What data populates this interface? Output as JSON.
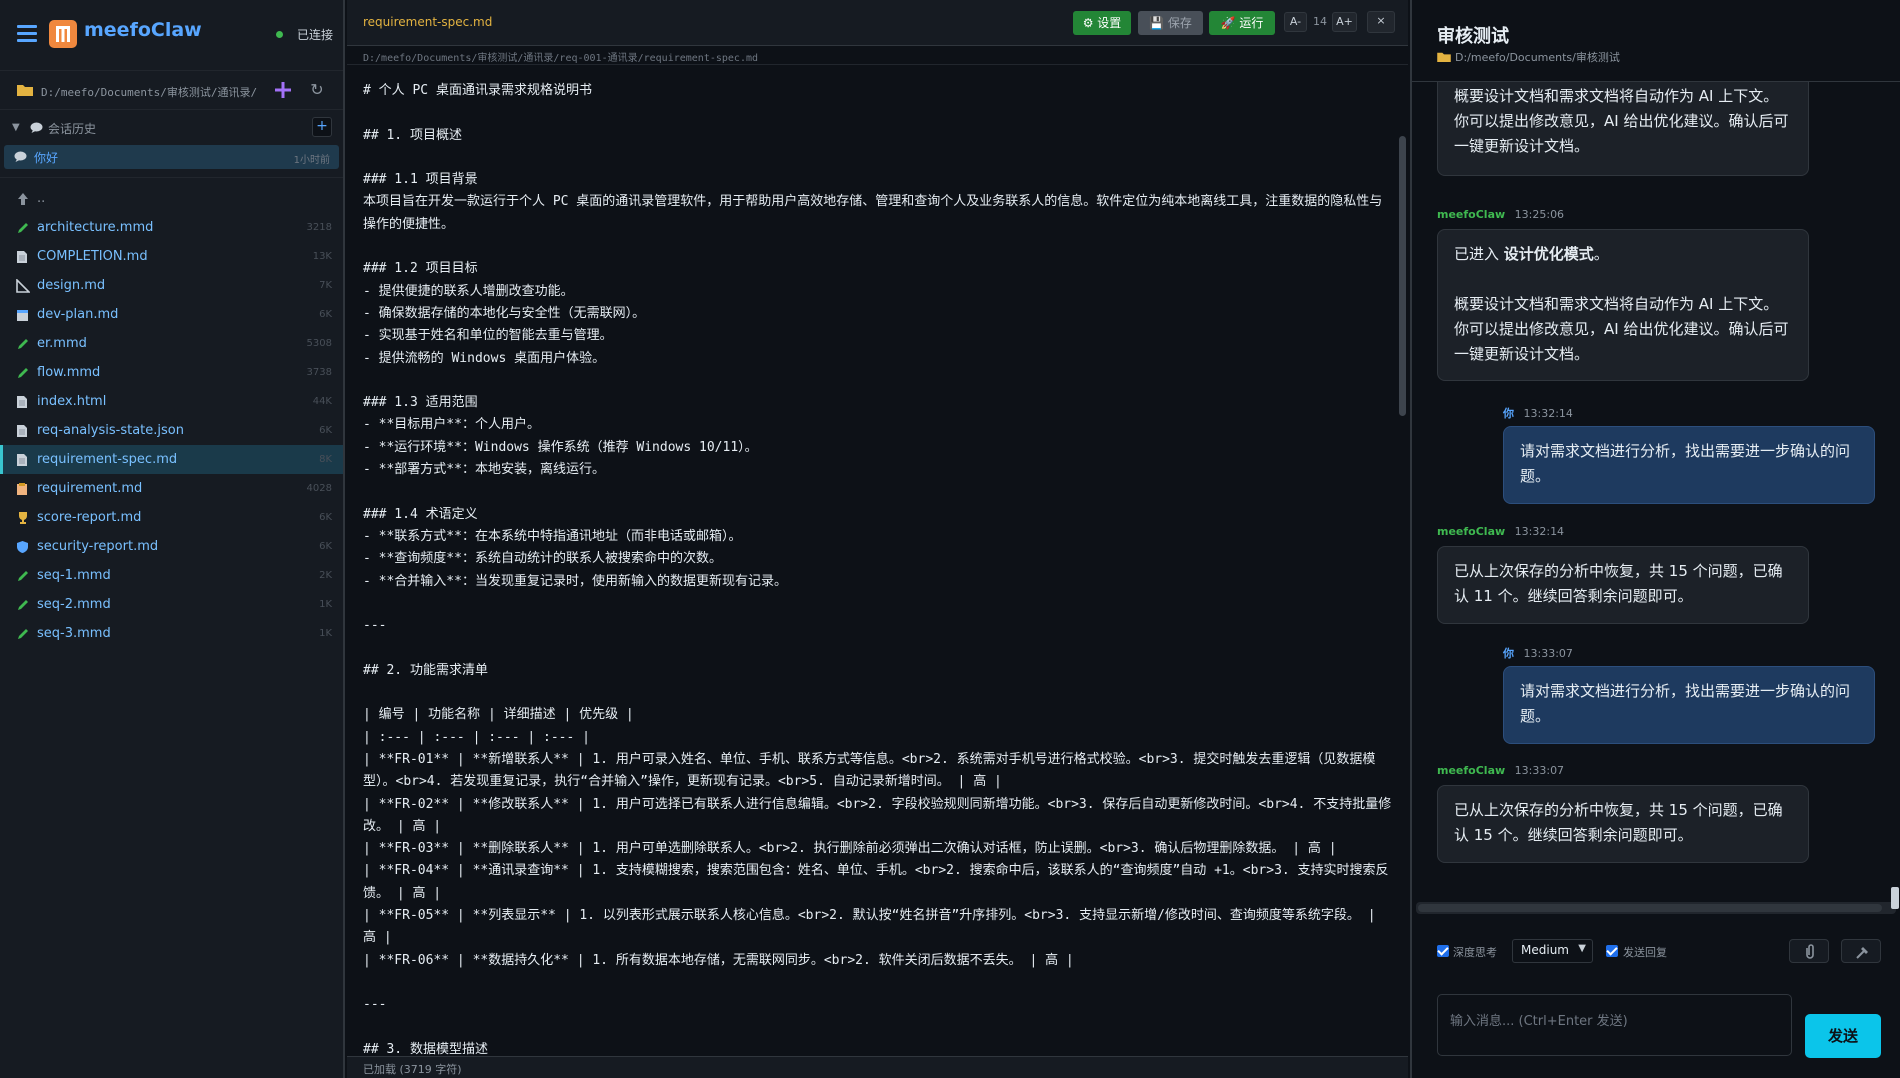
{
  "sidebar": {
    "app_name": "meefoClaw",
    "connection_status": "已连接",
    "current_path": "D:/meefo/Documents/审核测试/通讯录/r...",
    "history_label": "会话历史",
    "history_add": "+",
    "session": {
      "label": "你好",
      "time": "1小时前"
    },
    "parent_dir": "..",
    "files": [
      {
        "name": "architecture.mmd",
        "size": "3218",
        "icon": "pencil-icon"
      },
      {
        "name": "COMPLETION.md",
        "size": "13K",
        "icon": "document-icon"
      },
      {
        "name": "design.md",
        "size": "7K",
        "icon": "ruler-icon"
      },
      {
        "name": "dev-plan.md",
        "size": "6K",
        "icon": "calendar-icon"
      },
      {
        "name": "er.mmd",
        "size": "5308",
        "icon": "pencil-icon"
      },
      {
        "name": "flow.mmd",
        "size": "3738",
        "icon": "pencil-icon"
      },
      {
        "name": "index.html",
        "size": "44K",
        "icon": "document-icon"
      },
      {
        "name": "req-analysis-state.json",
        "size": "6K",
        "icon": "document-icon"
      },
      {
        "name": "requirement-spec.md",
        "size": "8K",
        "icon": "document-icon",
        "active": true
      },
      {
        "name": "requirement.md",
        "size": "4028",
        "icon": "clipboard-icon"
      },
      {
        "name": "score-report.md",
        "size": "6K",
        "icon": "trophy-icon"
      },
      {
        "name": "security-report.md",
        "size": "6K",
        "icon": "shield-icon"
      },
      {
        "name": "seq-1.mmd",
        "size": "2K",
        "icon": "pencil-icon"
      },
      {
        "name": "seq-2.mmd",
        "size": "1K",
        "icon": "pencil-icon"
      },
      {
        "name": "seq-3.mmd",
        "size": "1K",
        "icon": "pencil-icon"
      }
    ]
  },
  "editor": {
    "filename": "requirement-spec.md",
    "settings_label": "设置",
    "save_label": "保存",
    "run_label": "运行",
    "font_dec": "A-",
    "font_size": "14",
    "font_inc": "A+",
    "close": "×",
    "path": "D:/meefo/Documents/审核测试/通讯录/req-001-通讯录/requirement-spec.md",
    "status": "已加载 (3719 字符)",
    "lines": [
      "# 个人 PC 桌面通讯录需求规格说明书",
      "",
      "## 1. 项目概述",
      "",
      "### 1.1 项目背景",
      "本项目旨在开发一款运行于个人 PC 桌面的通讯录管理软件，用于帮助用户高效地存储、管理和查询个人及业务联系人的信息。软件定位为纯本地离线工具，注重数据的隐私性与操作的便捷性。",
      "",
      "### 1.2 项目目标",
      "- 提供便捷的联系人增删改查功能。",
      "- 确保数据存储的本地化与安全性（无需联网）。",
      "- 实现基于姓名和单位的智能去重与管理。",
      "- 提供流畅的 Windows 桌面用户体验。",
      "",
      "### 1.3 适用范围",
      "- **目标用户**：个人用户。",
      "- **运行环境**：Windows 操作系统（推荐 Windows 10/11）。",
      "- **部署方式**：本地安装，离线运行。",
      "",
      "### 1.4 术语定义",
      "- **联系方式**：在本系统中特指通讯地址（而非电话或邮箱）。",
      "- **查询频度**：系统自动统计的联系人被搜索命中的次数。",
      "- **合并输入**：当发现重复记录时，使用新输入的数据更新现有记录。",
      "",
      "---",
      "",
      "## 2. 功能需求清单",
      "",
      "| 编号 | 功能名称 | 详细描述 | 优先级 |",
      "| :--- | :--- | :--- | :--- |",
      "| **FR-01** | **新增联系人** | 1. 用户可录入姓名、单位、手机、联系方式等信息。<br>2. 系统需对手机号进行格式校验。<br>3. 提交时触发去重逻辑（见数据模型）。<br>4. 若发现重复记录，执行“合并输入”操作，更新现有记录。<br>5. 自动记录新增时间。 | 高 |",
      "| **FR-02** | **修改联系人** | 1. 用户可选择已有联系人进行信息编辑。<br>2. 字段校验规则同新增功能。<br>3. 保存后自动更新修改时间。<br>4. 不支持批量修改。 | 高 |",
      "| **FR-03** | **删除联系人** | 1. 用户可单选删除联系人。<br>2. 执行删除前必须弹出二次确认对话框，防止误删。<br>3. 确认后物理删除数据。 | 高 |",
      "| **FR-04** | **通讯录查询** | 1. 支持模糊搜索，搜索范围包含：姓名、单位、手机。<br>2. 搜索命中后，该联系人的“查询频度”自动 +1。<br>3. 支持实时搜索反馈。 | 高 |",
      "| **FR-05** | **列表显示** | 1. 以列表形式展示联系人核心信息。<br>2. 默认按“姓名拼音”升序排列。<br>3. 支持显示新增/修改时间、查询频度等系统字段。 | 高 |",
      "| **FR-06** | **数据持久化** | 1. 所有数据本地存储，无需联网同步。<br>2. 软件关闭后数据不丢失。 | 高 |",
      "",
      "---",
      "",
      "## 3. 数据模型描述"
    ]
  },
  "chat": {
    "title": "审核测试",
    "path": "D:/meefo/Documents/审核测试",
    "messages": [
      {
        "role": "ai",
        "who": "",
        "time": "",
        "paras": [
          "概要设计文档和需求文档将自动作为 AI 上下文。你可以提出修改意见，AI 给出优化建议。确认后可一键更新设计文档。"
        ]
      },
      {
        "role": "ai",
        "who": "meefoClaw",
        "time": "13:25:06",
        "paras": [
          "已进入 ",
          "设计优化模式",
          "。",
          "概要设计文档和需求文档将自动作为 AI 上下文。你可以提出修改意见，AI 给出优化建议。确认后可一键更新设计文档。"
        ]
      },
      {
        "role": "me",
        "who": "你",
        "time": "13:32:14",
        "paras": [
          "请对需求文档进行分析，找出需要进一步确认的问题。"
        ]
      },
      {
        "role": "ai",
        "who": "meefoClaw",
        "time": "13:32:14",
        "paras": [
          "已从上次保存的分析中恢复，共 15 个问题，已确认 11 个。继续回答剩余问题即可。"
        ]
      },
      {
        "role": "me",
        "who": "你",
        "time": "13:33:07",
        "paras": [
          "请对需求文档进行分析，找出需要进一步确认的问题。"
        ]
      },
      {
        "role": "ai",
        "who": "meefoClaw",
        "time": "13:33:07",
        "paras": [
          "已从上次保存的分析中恢复，共 15 个问题，已确认 15 个。继续回答剩余问题即可。"
        ]
      }
    ],
    "deep_think_label": "深度思考",
    "effort_value": "Medium",
    "send_reply_label": "发送回复",
    "input_placeholder": "输入消息... (Ctrl+Enter 发送)",
    "send_label": "发送"
  }
}
